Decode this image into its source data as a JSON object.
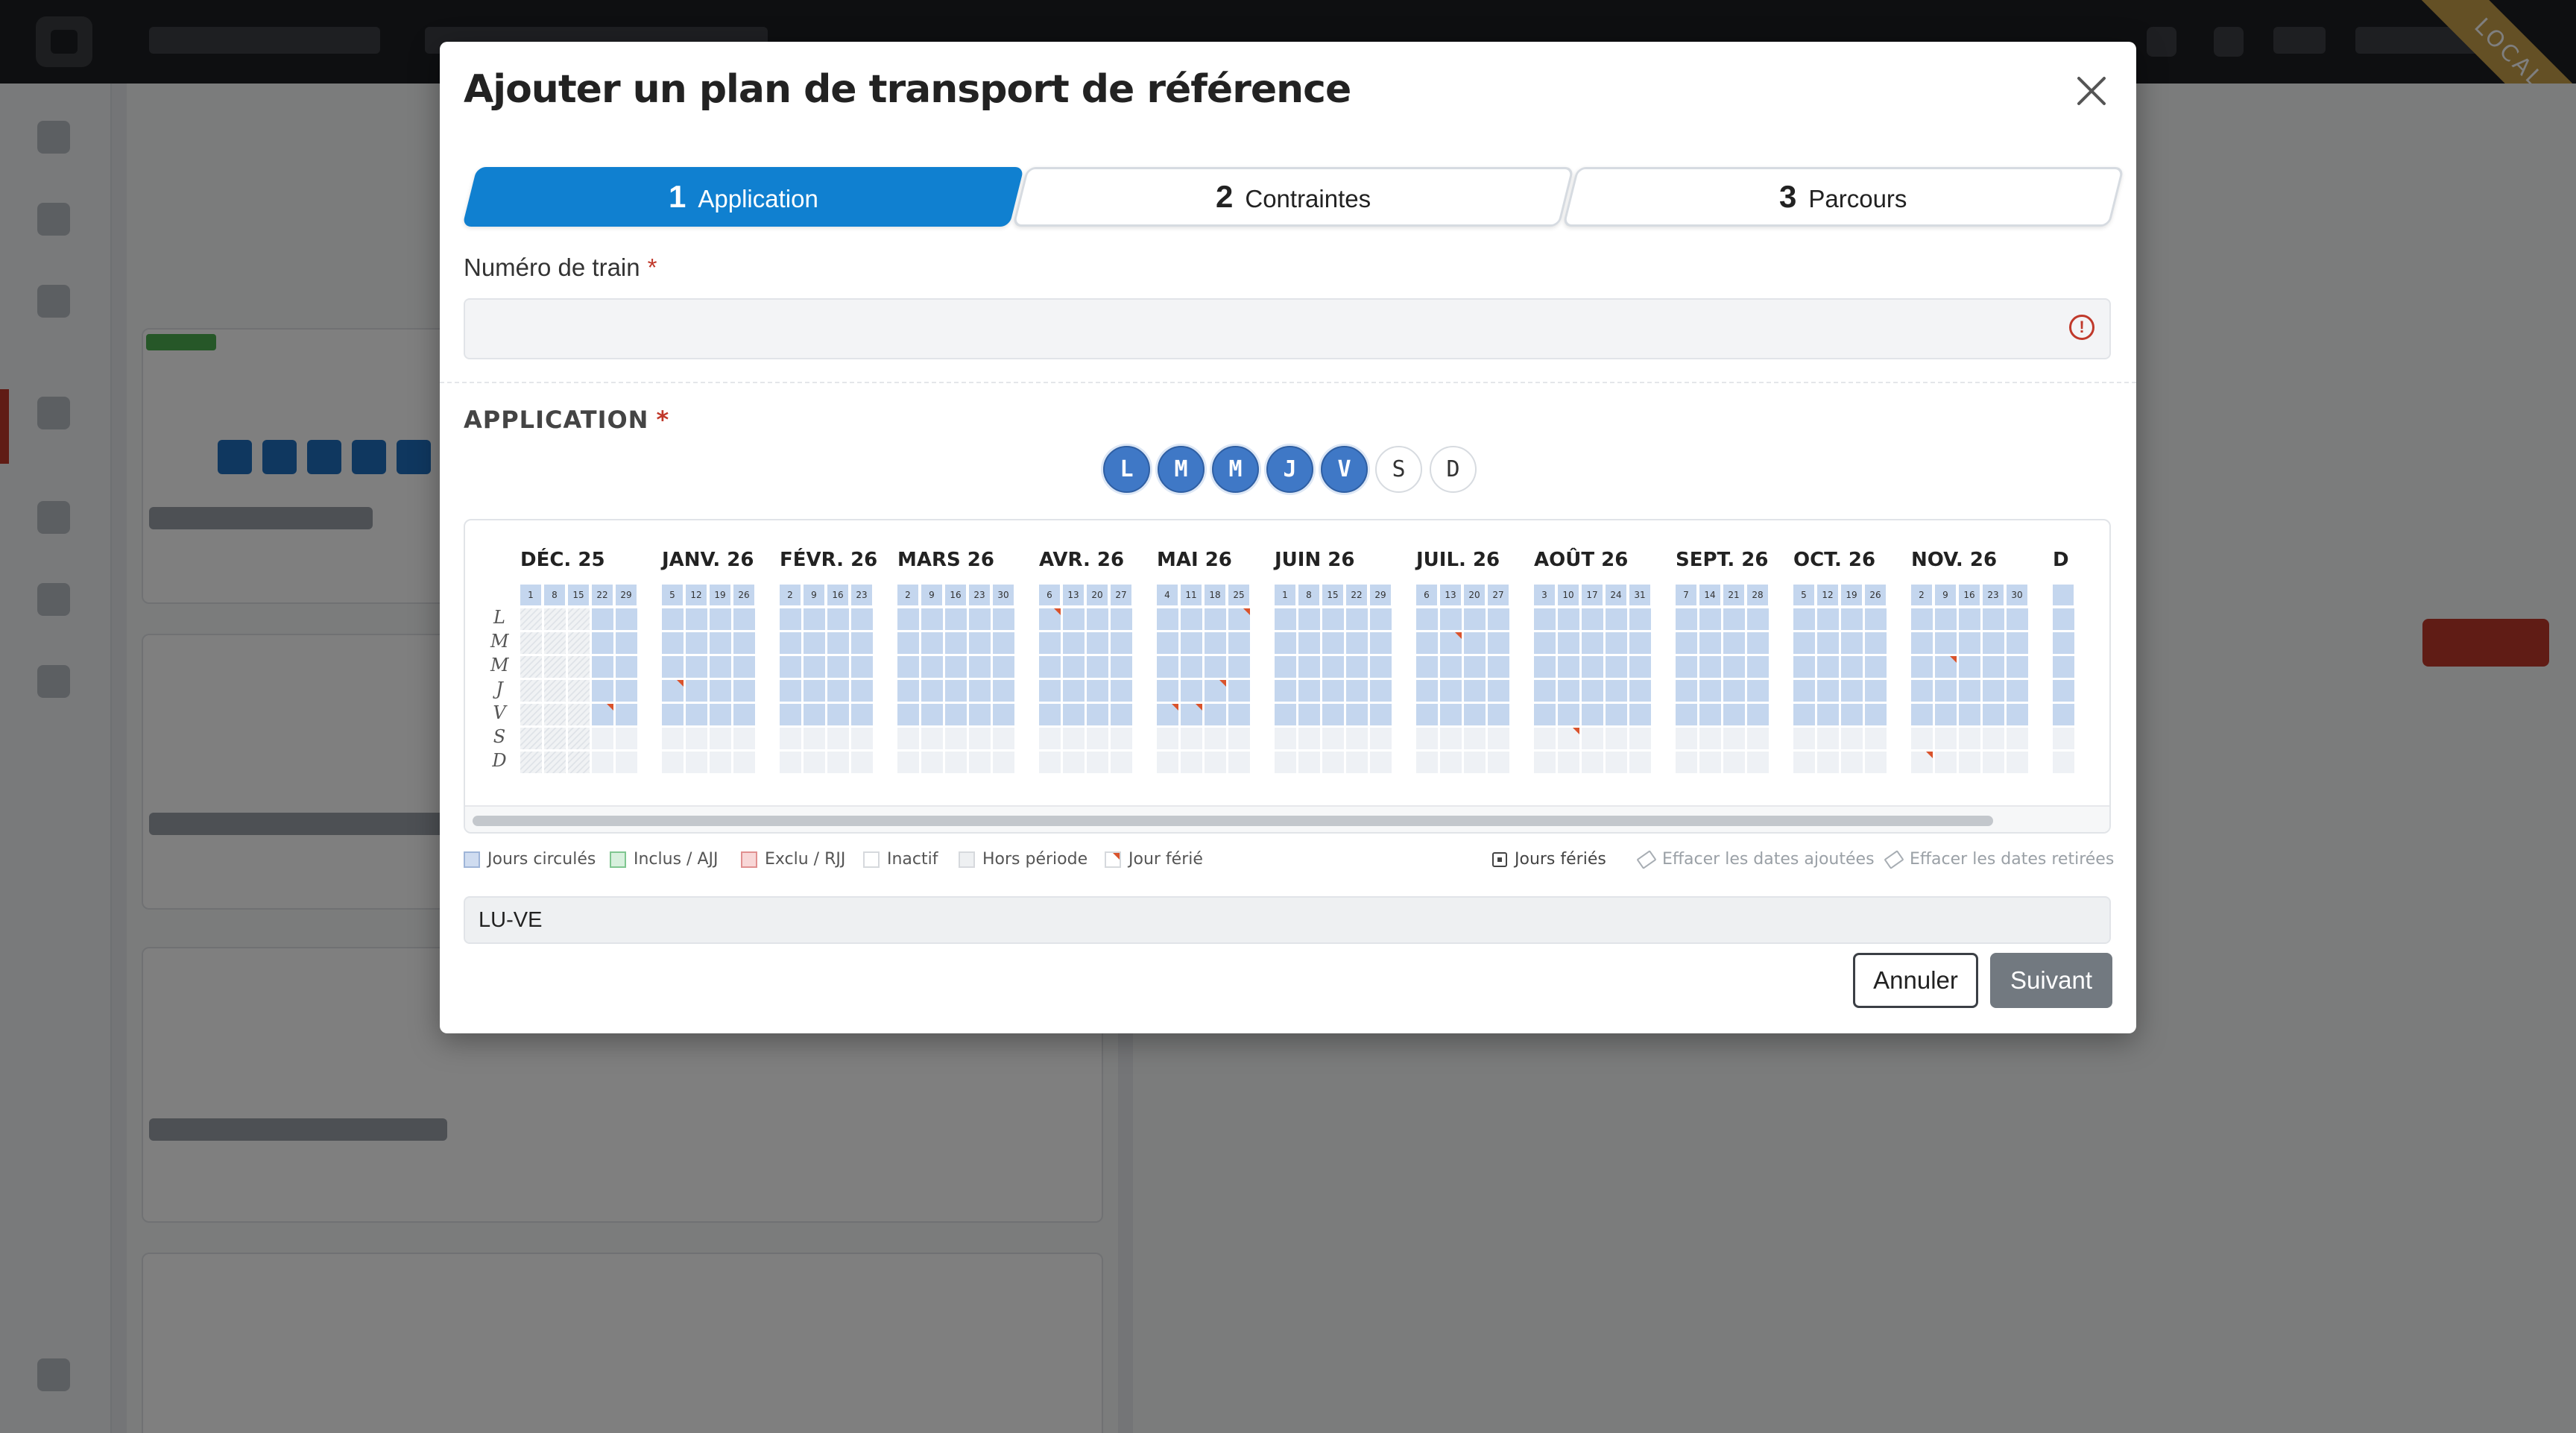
{
  "modal": {
    "title": "Ajouter un plan de transport de référence",
    "steps": [
      {
        "number": "1",
        "label": "Application",
        "active": true
      },
      {
        "number": "2",
        "label": "Contraintes",
        "active": false
      },
      {
        "number": "3",
        "label": "Parcours",
        "active": false
      }
    ],
    "train_number": {
      "label": "Numéro de train",
      "required_mark": "*",
      "value": ""
    },
    "application": {
      "title": "APPLICATION",
      "required_mark": "*",
      "weekdays": [
        {
          "label": "L",
          "selected": true
        },
        {
          "label": "M",
          "selected": true
        },
        {
          "label": "M",
          "selected": true
        },
        {
          "label": "J",
          "selected": true
        },
        {
          "label": "V",
          "selected": true
        },
        {
          "label": "S",
          "selected": false
        },
        {
          "label": "D",
          "selected": false
        }
      ]
    },
    "calendar": {
      "dow_labels": [
        "L",
        "M",
        "M",
        "J",
        "V",
        "S",
        "D"
      ],
      "months": [
        {
          "label": "DÉC. 25",
          "weeks": [
            "1",
            "8",
            "15",
            "22",
            "29"
          ],
          "out_weeks": 3,
          "holidays": [
            [
              3,
              4
            ]
          ]
        },
        {
          "label": "JANV. 26",
          "weeks": [
            "5",
            "12",
            "19",
            "26"
          ],
          "out_weeks": 0,
          "holidays": [
            [
              0,
              3
            ]
          ]
        },
        {
          "label": "FÉVR. 26",
          "weeks": [
            "2",
            "9",
            "16",
            "23"
          ],
          "out_weeks": 0,
          "holidays": []
        },
        {
          "label": "MARS 26",
          "weeks": [
            "2",
            "9",
            "16",
            "23",
            "30"
          ],
          "out_weeks": 0,
          "holidays": []
        },
        {
          "label": "AVR. 26",
          "weeks": [
            "6",
            "13",
            "20",
            "27"
          ],
          "out_weeks": 0,
          "holidays": [
            [
              0,
              0
            ]
          ]
        },
        {
          "label": "MAI 26",
          "weeks": [
            "4",
            "11",
            "18",
            "25"
          ],
          "out_weeks": 0,
          "holidays": [
            [
              0,
              4
            ],
            [
              1,
              4
            ],
            [
              2,
              3
            ],
            [
              3,
              0
            ]
          ]
        },
        {
          "label": "JUIN 26",
          "weeks": [
            "1",
            "8",
            "15",
            "22",
            "29"
          ],
          "out_weeks": 0,
          "holidays": []
        },
        {
          "label": "JUIL. 26",
          "weeks": [
            "6",
            "13",
            "20",
            "27"
          ],
          "out_weeks": 0,
          "holidays": [
            [
              1,
              1
            ]
          ]
        },
        {
          "label": "AOÛT 26",
          "weeks": [
            "3",
            "10",
            "17",
            "24",
            "31"
          ],
          "out_weeks": 0,
          "holidays": [
            [
              1,
              5
            ]
          ]
        },
        {
          "label": "SEPT. 26",
          "weeks": [
            "7",
            "14",
            "21",
            "28"
          ],
          "out_weeks": 0,
          "holidays": []
        },
        {
          "label": "OCT. 26",
          "weeks": [
            "5",
            "12",
            "19",
            "26"
          ],
          "out_weeks": 0,
          "holidays": []
        },
        {
          "label": "NOV. 26",
          "weeks": [
            "2",
            "9",
            "16",
            "23",
            "30"
          ],
          "out_weeks": 0,
          "holidays": [
            [
              0,
              6
            ],
            [
              1,
              2
            ]
          ]
        },
        {
          "label": "D",
          "weeks": [
            ""
          ],
          "out_weeks": 0,
          "holidays": []
        }
      ]
    },
    "legend": [
      {
        "label": "Jours circulés",
        "color": "#cfdcf0",
        "border": "#9fb5d8"
      },
      {
        "label": "Inclus / AJJ",
        "color": "#d7f0dd",
        "border": "#7fc690"
      },
      {
        "label": "Exclu / RJJ",
        "color": "#f8d7d7",
        "border": "#e09090"
      },
      {
        "label": "Inactif",
        "color": "#ffffff",
        "border": "#d6d9dd"
      },
      {
        "label": "Hors période",
        "color": "#eef0f2",
        "border": "#d6d9dd"
      },
      {
        "label": "Jour férié",
        "color": "#ffffff",
        "border": "#d6d9dd"
      }
    ],
    "legend_actions": {
      "holidays": "Jours fériés",
      "clear_added": "Effacer les dates ajoutées",
      "clear_removed": "Effacer les dates retirées"
    },
    "summary_value": "LU-VE",
    "buttons": {
      "cancel": "Annuler",
      "next": "Suivant"
    }
  },
  "environment_badge": "LOCAL"
}
